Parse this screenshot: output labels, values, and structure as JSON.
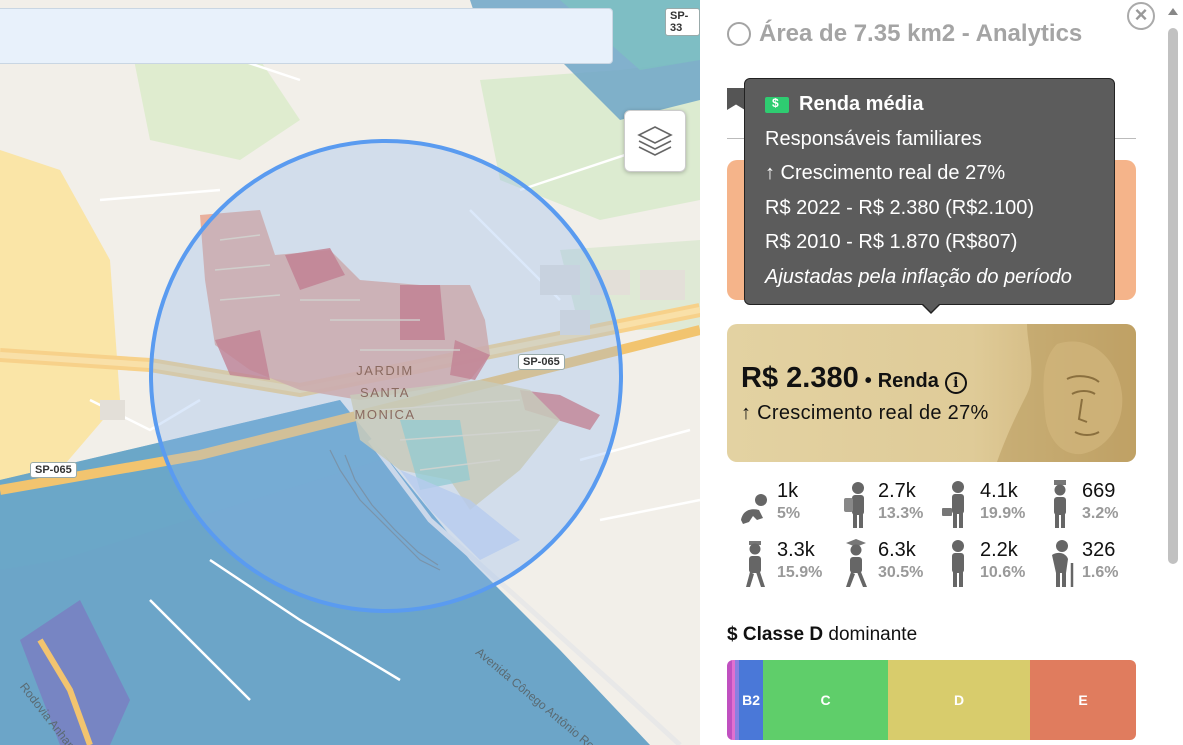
{
  "panel": {
    "title": "Área de 7.35 km2 - Analytics",
    "close_glyph": "×"
  },
  "map": {
    "roads": {
      "sp065_right": "SP-065",
      "sp065_left": "SP-065",
      "sp3x_top": "SP-33"
    },
    "area_label_line1": "JARDIM SANTA",
    "area_label_line2": "MONICA",
    "street_1": "Avenida Cônego Antônio Roccato",
    "street_2": "Rodovia Anhangu"
  },
  "tooltip": {
    "title": "Renda média",
    "subtitle": "Responsáveis familiares",
    "growth": "↑ Crescimento real de 27%",
    "line_2022": "R$ 2022 - R$ 2.380 (R$2.100)",
    "line_2010": "R$ 2010 - R$ 1.870 (R$807)",
    "note": "Ajustadas pela inflação do período",
    "icon": "money-bill-icon"
  },
  "renda": {
    "value": "R$ 2.380",
    "separator": "•",
    "label": "Renda",
    "info_glyph": "i",
    "growth": "↑ Crescimento real de 27%"
  },
  "age_groups": [
    {
      "icon": "baby-crawling-icon",
      "count": "1k",
      "pct": "5%"
    },
    {
      "icon": "student-backpack-icon",
      "count": "2.7k",
      "pct": "13.3%"
    },
    {
      "icon": "adult-briefcase-icon",
      "count": "4.1k",
      "pct": "19.9%"
    },
    {
      "icon": "nurse-icon",
      "count": "669",
      "pct": "3.2%"
    },
    {
      "icon": "child-walking-icon",
      "count": "3.3k",
      "pct": "15.9%"
    },
    {
      "icon": "graduate-icon",
      "count": "6.3k",
      "pct": "30.5%"
    },
    {
      "icon": "person-standing-icon",
      "count": "2.2k",
      "pct": "10.6%"
    },
    {
      "icon": "elderly-cane-icon",
      "count": "326",
      "pct": "1.6%"
    }
  ],
  "classe": {
    "prefix": "$",
    "class_name": "Classe D",
    "suffix": "dominante",
    "segments": [
      {
        "label": "",
        "share": 0.012,
        "color": "#c050c0"
      },
      {
        "label": "",
        "share": 0.008,
        "color": "#e070d0"
      },
      {
        "label": "",
        "share": 0.01,
        "color": "#8a7fe0"
      },
      {
        "label": "B2",
        "share": 0.058,
        "color": "#4a78d8"
      },
      {
        "label": "C",
        "share": 0.306,
        "color": "#5fce6a"
      },
      {
        "label": "D",
        "share": 0.347,
        "color": "#d8cc6c"
      },
      {
        "label": "E",
        "share": 0.259,
        "color": "#e07c5e"
      }
    ]
  },
  "colors": {
    "tooltip_bg": "#5c5c5c",
    "renda_card": "#e3d2a2",
    "orange_card": "#f5b48a",
    "selection_circle": "#5a9bf0"
  }
}
